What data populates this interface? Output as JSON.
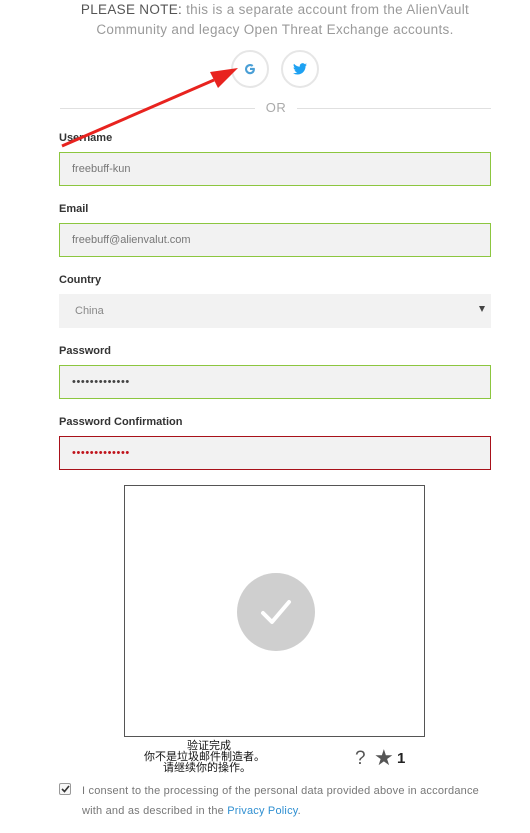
{
  "notice": {
    "bold": "PLEASE NOTE:",
    "line1_rest": " this is a separate account from the AlienVault",
    "line2": "Community and legacy Open Threat Exchange accounts."
  },
  "social": {
    "google_icon": "google-g",
    "twitter_icon": "twitter-bird",
    "google_color": "#4a9fd6",
    "twitter_color": "#1da1f2"
  },
  "divider_text": "OR",
  "form": {
    "username": {
      "label": "Username",
      "value": "freebuff-kun"
    },
    "email": {
      "label": "Email",
      "value": "freebuff@alienvalut.com"
    },
    "country": {
      "label": "Country",
      "value": "China"
    },
    "password": {
      "label": "Password",
      "value": "•••••••••••••"
    },
    "password_confirmation": {
      "label": "Password Confirmation",
      "value": "•••••••••••••"
    }
  },
  "captcha": {
    "line1": "验证完成",
    "line2": "你不是垃圾邮件制造者。",
    "line3": "请继续你的操作。",
    "help": "?",
    "star": "★",
    "count": "1"
  },
  "consent": {
    "text": "I consent to the processing of the personal data provided above in accordance with and as described in the ",
    "link": "Privacy Policy",
    "end": ".",
    "checked": true
  },
  "colors": {
    "valid_border": "#8cc63f",
    "error_border": "#a8111a",
    "link": "#2f8fd1",
    "annotation_arrow": "#e8231f"
  }
}
